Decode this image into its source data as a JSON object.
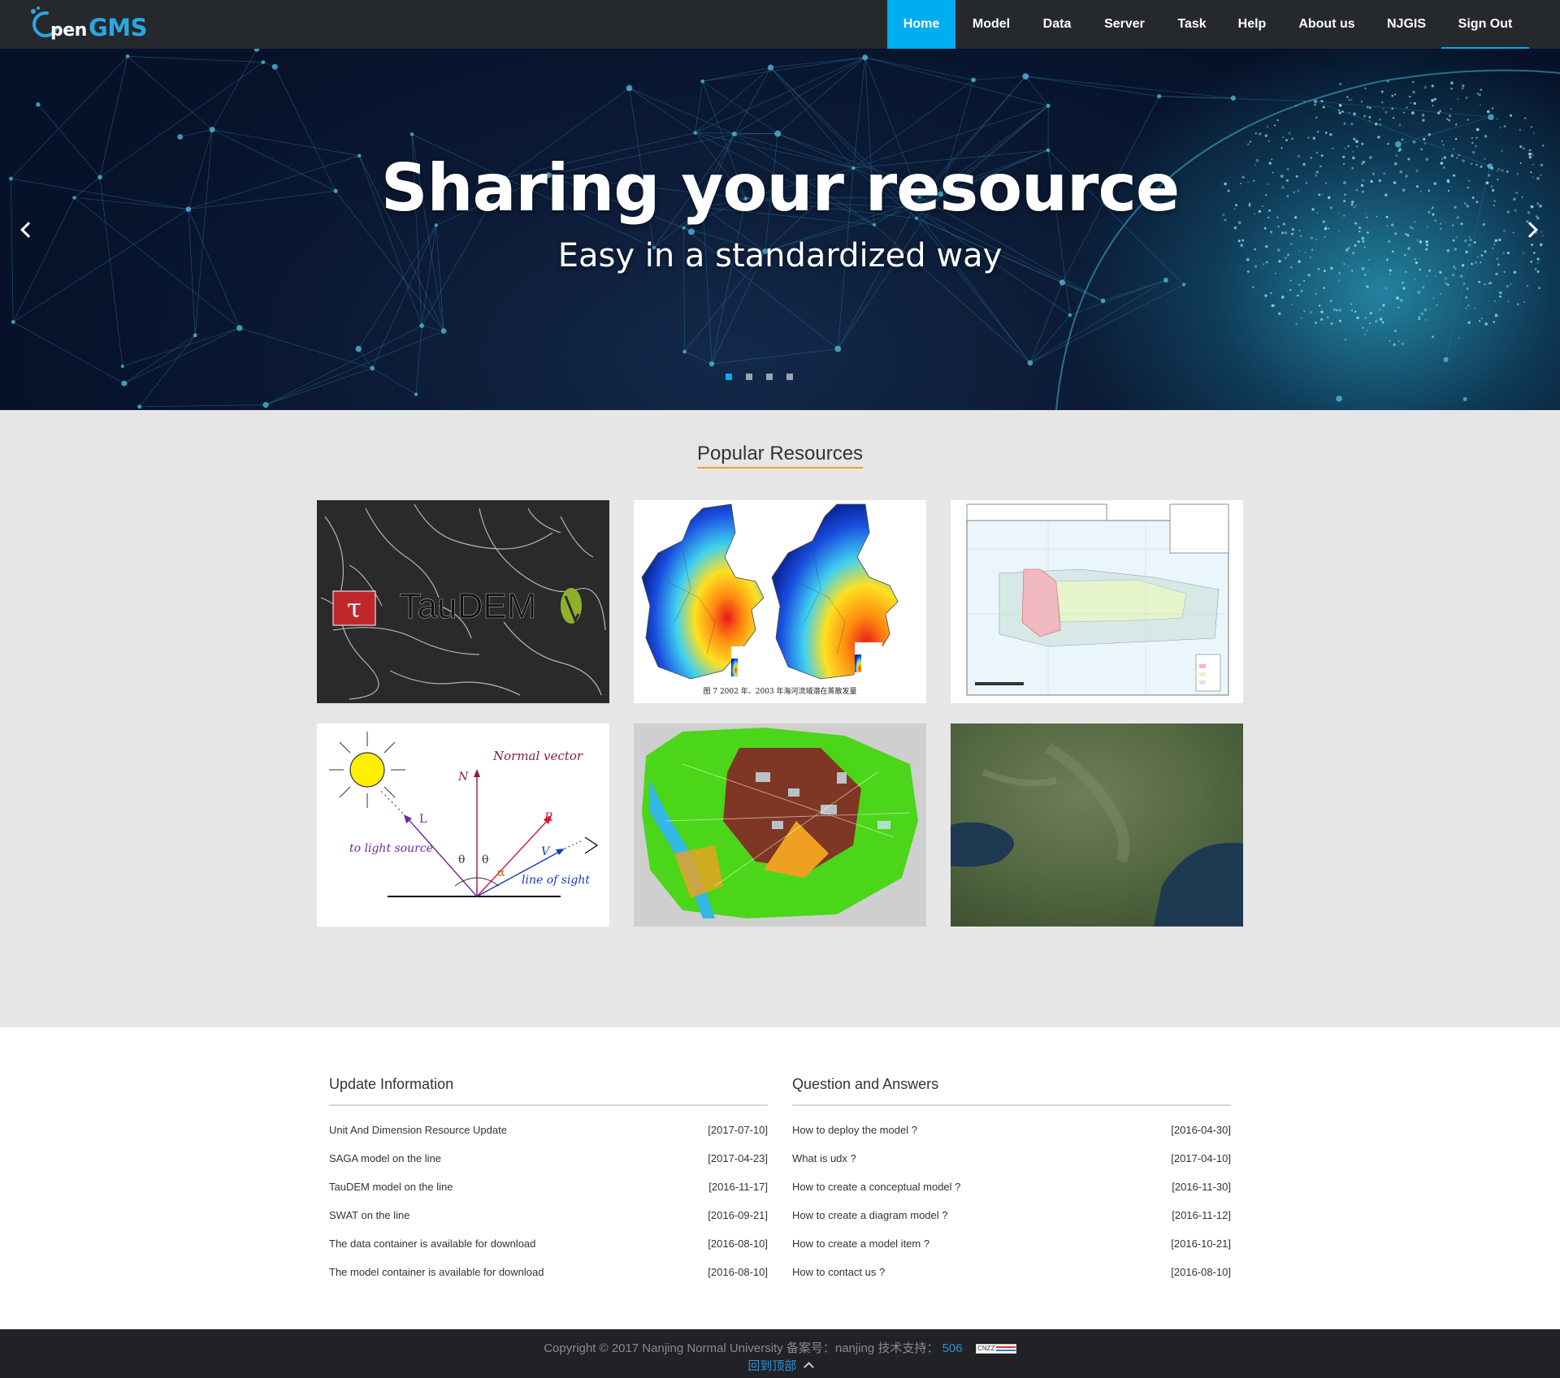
{
  "brand": {
    "logo_text_pen": "pen",
    "logo_text_gms": "GMS"
  },
  "nav": {
    "items": [
      "Home",
      "Model",
      "Data",
      "Server",
      "Task",
      "Help",
      "About us",
      "NJGIS",
      "Sign Out"
    ],
    "active": "Home"
  },
  "hero": {
    "title": "Sharing your resource",
    "subtitle": "Easy in a standardized way",
    "slide_count": 4,
    "active_slide": 1
  },
  "popular": {
    "title": "Popular Resources",
    "cards": [
      {
        "name": "taudem",
        "text": "TauDEM"
      },
      {
        "name": "temperature-maps",
        "text": ""
      },
      {
        "name": "protected-area-map",
        "text": ""
      },
      {
        "name": "reflection-diagram",
        "labels": [
          "Normal vector",
          "N",
          "L",
          "R",
          "V",
          "to light source",
          "line of sight",
          "θ",
          "θ",
          "α"
        ]
      },
      {
        "name": "land-use-map",
        "text": ""
      },
      {
        "name": "satellite-image",
        "text": ""
      }
    ]
  },
  "updates": {
    "title": "Update Information",
    "items": [
      {
        "text": "Unit And Dimension Resource Update",
        "date": "[2017-07-10]"
      },
      {
        "text": "SAGA model on the line",
        "date": "[2017-04-23]"
      },
      {
        "text": "TauDEM model on the line",
        "date": "[2016-11-17]"
      },
      {
        "text": "SWAT on the line",
        "date": "[2016-09-21]"
      },
      {
        "text": "The data container is available for download",
        "date": "[2016-08-10]"
      },
      {
        "text": "The model container is available for download",
        "date": "[2016-08-10]"
      }
    ]
  },
  "qa": {
    "title": "Question and Answers",
    "items": [
      {
        "text": "How to deploy the model ?",
        "date": "[2016-04-30]"
      },
      {
        "text": "What is udx ?",
        "date": "[2017-04-10]"
      },
      {
        "text": "How to create a conceptual model ?",
        "date": "[2016-11-30]"
      },
      {
        "text": "How to create a diagram model ?",
        "date": "[2016-11-12]"
      },
      {
        "text": "How to create a model item ?",
        "date": "[2016-10-21]"
      },
      {
        "text": "How to contact us ?",
        "date": "[2016-08-10]"
      }
    ]
  },
  "footer": {
    "copyright": "Copyright © 2017 Nanjing Normal University 备案号：nanjing 技术支持：",
    "support_number": "506",
    "cnzz_label": "CNZZ",
    "back_to_top": "回到顶部"
  },
  "colors": {
    "accent": "#00aeef",
    "nav_bg": "#25282d",
    "footer_bg": "#202226",
    "underline": "#f0a030"
  }
}
